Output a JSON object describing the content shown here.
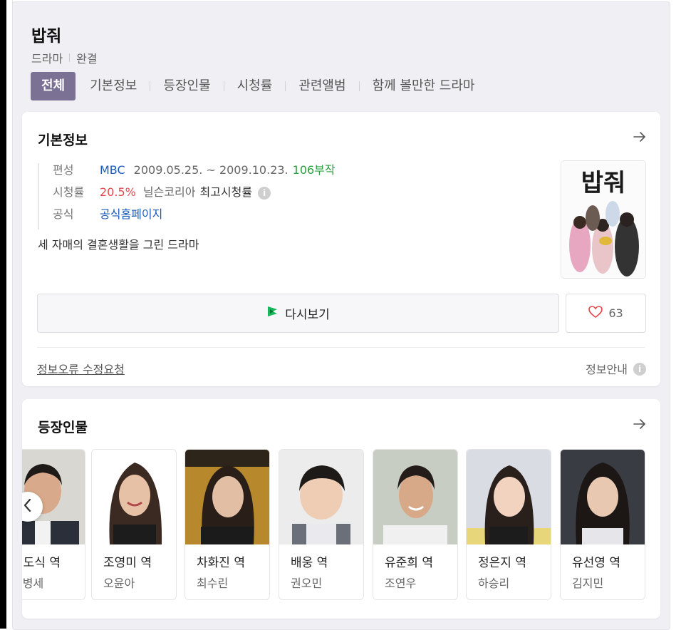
{
  "header": {
    "title": "밥줘",
    "category": "드라마",
    "status": "완결"
  },
  "tabs": [
    {
      "label": "전체",
      "active": true
    },
    {
      "label": "기본정보",
      "active": false
    },
    {
      "label": "등장인물",
      "active": false
    },
    {
      "label": "시청률",
      "active": false
    },
    {
      "label": "관련앨범",
      "active": false
    },
    {
      "label": "함께 볼만한 드라마",
      "active": false
    }
  ],
  "basic_info": {
    "section_title": "기본정보",
    "broadcast_label": "편성",
    "broadcaster": "MBC",
    "period": "2009.05.25. ~ 2009.10.23.",
    "episodes": "106부작",
    "rating_label": "시청률",
    "rating_value": "20.5%",
    "rating_source": "닐슨코리아",
    "rating_note": "최고시청률",
    "official_label": "공식",
    "official_link": "공식홈페이지",
    "description": "세 자매의 결혼생활을 그린 드라마",
    "poster_text": "밥줘",
    "replay_label": "다시보기",
    "like_count": "63",
    "report_link": "정보오류 수정요청",
    "info_guide": "정보안내"
  },
  "cast": {
    "section_title": "등장인물",
    "members": [
      {
        "role": "배도식 역",
        "actor": "김병세"
      },
      {
        "role": "조영미 역",
        "actor": "오윤아"
      },
      {
        "role": "차화진 역",
        "actor": "최수린"
      },
      {
        "role": "배웅 역",
        "actor": "권오민"
      },
      {
        "role": "유준희 역",
        "actor": "조연우"
      },
      {
        "role": "정은지 역",
        "actor": "하승리"
      },
      {
        "role": "유선영 역",
        "actor": "김지민"
      }
    ]
  },
  "colors": {
    "accent_tab": "#7a7194",
    "link_blue": "#1b5bb8",
    "episodes_green": "#2a9d3c",
    "rating_red": "#e6454e",
    "panel_bg": "#f0eff4"
  }
}
